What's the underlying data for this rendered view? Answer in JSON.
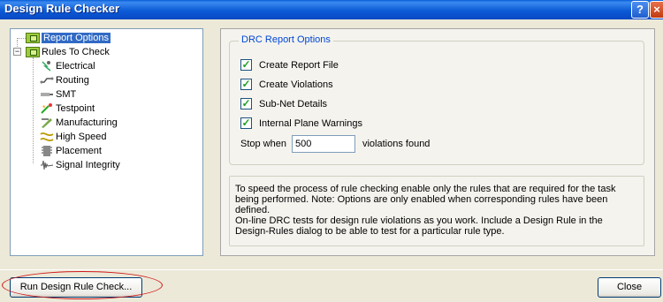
{
  "window": {
    "title": "Design Rule Checker",
    "help_glyph": "?",
    "close_glyph": "×"
  },
  "tree": {
    "root1": {
      "label": "Report Options",
      "expander": ""
    },
    "root2": {
      "label": "Rules To Check",
      "expander": "−"
    },
    "children": [
      {
        "label": "Electrical",
        "icon": "electrical-icon"
      },
      {
        "label": "Routing",
        "icon": "routing-icon"
      },
      {
        "label": "SMT",
        "icon": "smt-icon"
      },
      {
        "label": "Testpoint",
        "icon": "testpoint-icon"
      },
      {
        "label": "Manufacturing",
        "icon": "manufacturing-icon"
      },
      {
        "label": "High Speed",
        "icon": "high-speed-icon"
      },
      {
        "label": "Placement",
        "icon": "placement-icon"
      },
      {
        "label": "Signal Integrity",
        "icon": "signal-integrity-icon"
      }
    ]
  },
  "report": {
    "group_title": "DRC Report Options",
    "options": [
      {
        "label": "Create Report File",
        "checked": true
      },
      {
        "label": "Create Violations",
        "checked": true
      },
      {
        "label": "Sub-Net Details",
        "checked": true
      },
      {
        "label": "Internal Plane Warnings",
        "checked": true
      }
    ],
    "stop_when_label": "Stop when",
    "stop_value": "500",
    "violations_label": "violations found",
    "description": "To speed the process of rule checking enable only the rules that are required for the task being performed.  Note: Options are only enabled when corresponding rules have been defined.\nOn-line DRC tests for design rule violations as you work. Include a Design Rule in the Design-Rules dialog to be able to test for a particular rule  type."
  },
  "buttons": {
    "run": "Run Design Rule Check...",
    "close": "Close"
  },
  "colors": {
    "titlebar": "#0a5fd8",
    "selection": "#316ac5",
    "highlight_ellipse": "#d01818",
    "dialog_bg": "#ece9d8"
  }
}
